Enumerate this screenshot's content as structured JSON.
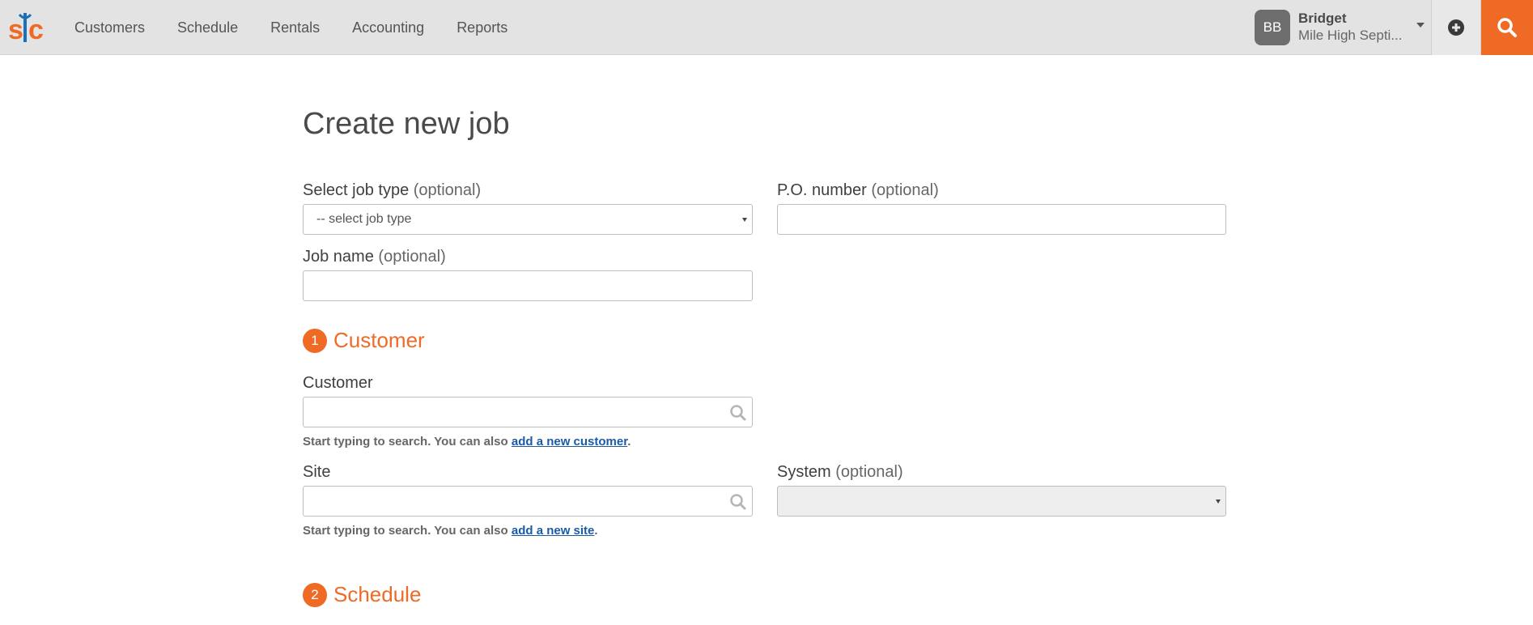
{
  "nav": {
    "items": [
      "Customers",
      "Schedule",
      "Rentals",
      "Accounting",
      "Reports"
    ]
  },
  "user": {
    "initials": "BB",
    "name": "Bridget",
    "company": "Mile High Septi..."
  },
  "icons": {
    "logo": "sic-logo",
    "add": "plus-circle-icon",
    "search": "search-icon",
    "caret": "caret-down-icon"
  },
  "colors": {
    "accent": "#ef6a25",
    "logo_blue": "#1d6fb8",
    "link": "#1a5aa6",
    "topbar": "#e3e3e3"
  },
  "form": {
    "title": "Create new job",
    "job_type": {
      "label": "Select job type",
      "optional": "(optional)",
      "selected": "-- select job type"
    },
    "po_number": {
      "label": "P.O. number",
      "optional": "(optional)",
      "value": ""
    },
    "job_name": {
      "label": "Job name",
      "optional": "(optional)",
      "value": ""
    },
    "section_customer": {
      "number": "1",
      "title": "Customer"
    },
    "customer": {
      "label": "Customer",
      "value": "",
      "help_prefix": "Start typing to search. You can also",
      "help_link": "add a new customer",
      "help_suffix": "."
    },
    "site": {
      "label": "Site",
      "value": "",
      "help_prefix": "Start typing to search. You can also",
      "help_link": "add a new site",
      "help_suffix": "."
    },
    "system": {
      "label": "System",
      "optional": "(optional)",
      "selected": ""
    },
    "section_schedule": {
      "number": "2",
      "title": "Schedule"
    }
  }
}
